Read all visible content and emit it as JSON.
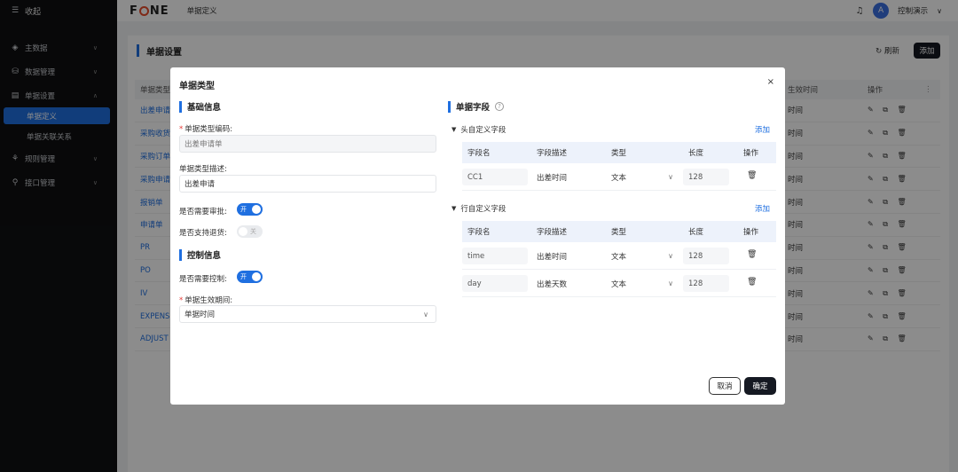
{
  "sidebar": {
    "collapse_label": "收起",
    "items": [
      {
        "label": "主数据",
        "icon": "cube-icon",
        "chevron": "∨"
      },
      {
        "label": "数据管理",
        "icon": "database-icon",
        "chevron": "∨"
      },
      {
        "label": "单据设置",
        "icon": "document-icon",
        "chevron": "∧"
      },
      {
        "label": "规则管理",
        "icon": "rule-icon",
        "chevron": "∨"
      },
      {
        "label": "接口管理",
        "icon": "api-icon",
        "chevron": "∨"
      }
    ],
    "sub_items": [
      "单据定义",
      "单据关联关系"
    ]
  },
  "topbar": {
    "logo_left": "F",
    "logo_right": "NE",
    "breadcrumb": "单据定义",
    "avatar_letter": "A",
    "user_name": "控制演示",
    "user_chevron": "∨"
  },
  "content": {
    "title": "单据设置",
    "refresh_label": "刷新",
    "add_label": "添加",
    "columns": {
      "type": "单据类型",
      "effective": "生效时间",
      "ops": "操作",
      "more": "⋮"
    },
    "ops_icons": "✎ ⧉ 🗑",
    "rows": [
      {
        "name": "出差申请",
        "time": "时间"
      },
      {
        "name": "采购收货",
        "time": "时间"
      },
      {
        "name": "采购订单",
        "time": "时间"
      },
      {
        "name": "采购申请",
        "time": "时间"
      },
      {
        "name": "报销单",
        "time": "时间"
      },
      {
        "name": "申请单",
        "time": "时间"
      },
      {
        "name": "PR",
        "time": "时间"
      },
      {
        "name": "PO",
        "time": "时间"
      },
      {
        "name": "IV",
        "time": "时间"
      },
      {
        "name": "EXPENS",
        "time": "时间"
      },
      {
        "name": "ADJUST",
        "time": "时间"
      }
    ]
  },
  "modal": {
    "title": "单据类型",
    "close": "×",
    "basic_section": "基础信息",
    "code_label": "单据类型编码:",
    "code_value": "出差申请单",
    "desc_label": "单据类型描述:",
    "desc_value": "出差申请",
    "approval_label": "是否需要审批:",
    "approval_toggle": "开",
    "return_label": "是否支持退货:",
    "return_toggle": "关",
    "control_section": "控制信息",
    "control_label": "是否需要控制:",
    "control_toggle": "开",
    "period_label": "单据生效期间:",
    "period_value": "单据时间",
    "fields_section": "单据字段",
    "header_group": "头自定义字段",
    "line_group": "行自定义字段",
    "add_label": "添加",
    "field_columns": [
      "字段名",
      "字段描述",
      "类型",
      "长度",
      "操作"
    ],
    "header_fields": [
      {
        "name": "CC1",
        "desc": "出差时间",
        "type": "文本",
        "length": "128"
      }
    ],
    "line_fields": [
      {
        "name": "time",
        "desc": "出差时间",
        "type": "文本",
        "length": "128"
      },
      {
        "name": "day",
        "desc": "出差天数",
        "type": "文本",
        "length": "128"
      }
    ],
    "cancel_label": "取消",
    "ok_label": "确定"
  }
}
